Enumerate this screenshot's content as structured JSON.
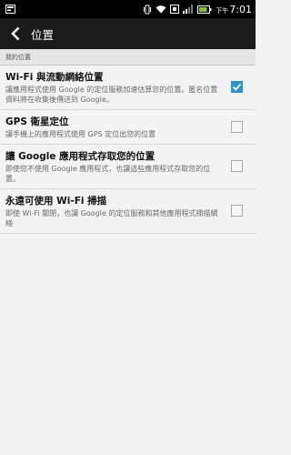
{
  "status_bar": {
    "time_prefix": "下午",
    "time": "7:01",
    "battery_level": 0.85,
    "icons": [
      "vibrate-icon",
      "wifi-icon",
      "nfc-icon",
      "signal-icon",
      "battery-icon"
    ]
  },
  "action_bar": {
    "title": "位置"
  },
  "section": {
    "header": "我的位置"
  },
  "settings": [
    {
      "title": "Wi-Fi 與流動網絡位置",
      "summary": "讓應用程式使用 Google 的定位服務加速估算您的位置。匿名位置資料將在收集後傳送到 Google。",
      "checked": true
    },
    {
      "title": "GPS 衛星定位",
      "summary": "讓手機上的應用程式使用 GPS 定位出您的位置",
      "checked": false
    },
    {
      "title": "讓 Google 應用程式存取您的位置",
      "summary": "即使您不使用 Google 應用程式，也讓這些應用程式存取您的位置。",
      "checked": false
    },
    {
      "title": "永遠可使用 Wi-Fi 掃描",
      "summary": "即使 Wi-Fi 關閉，也讓 Google 的定位服務和其他應用程式掃描網絡",
      "checked": false
    }
  ],
  "colors": {
    "accent": "#2d92cf",
    "action_bar": "#1b1b1b",
    "background": "#f3f3f3"
  }
}
